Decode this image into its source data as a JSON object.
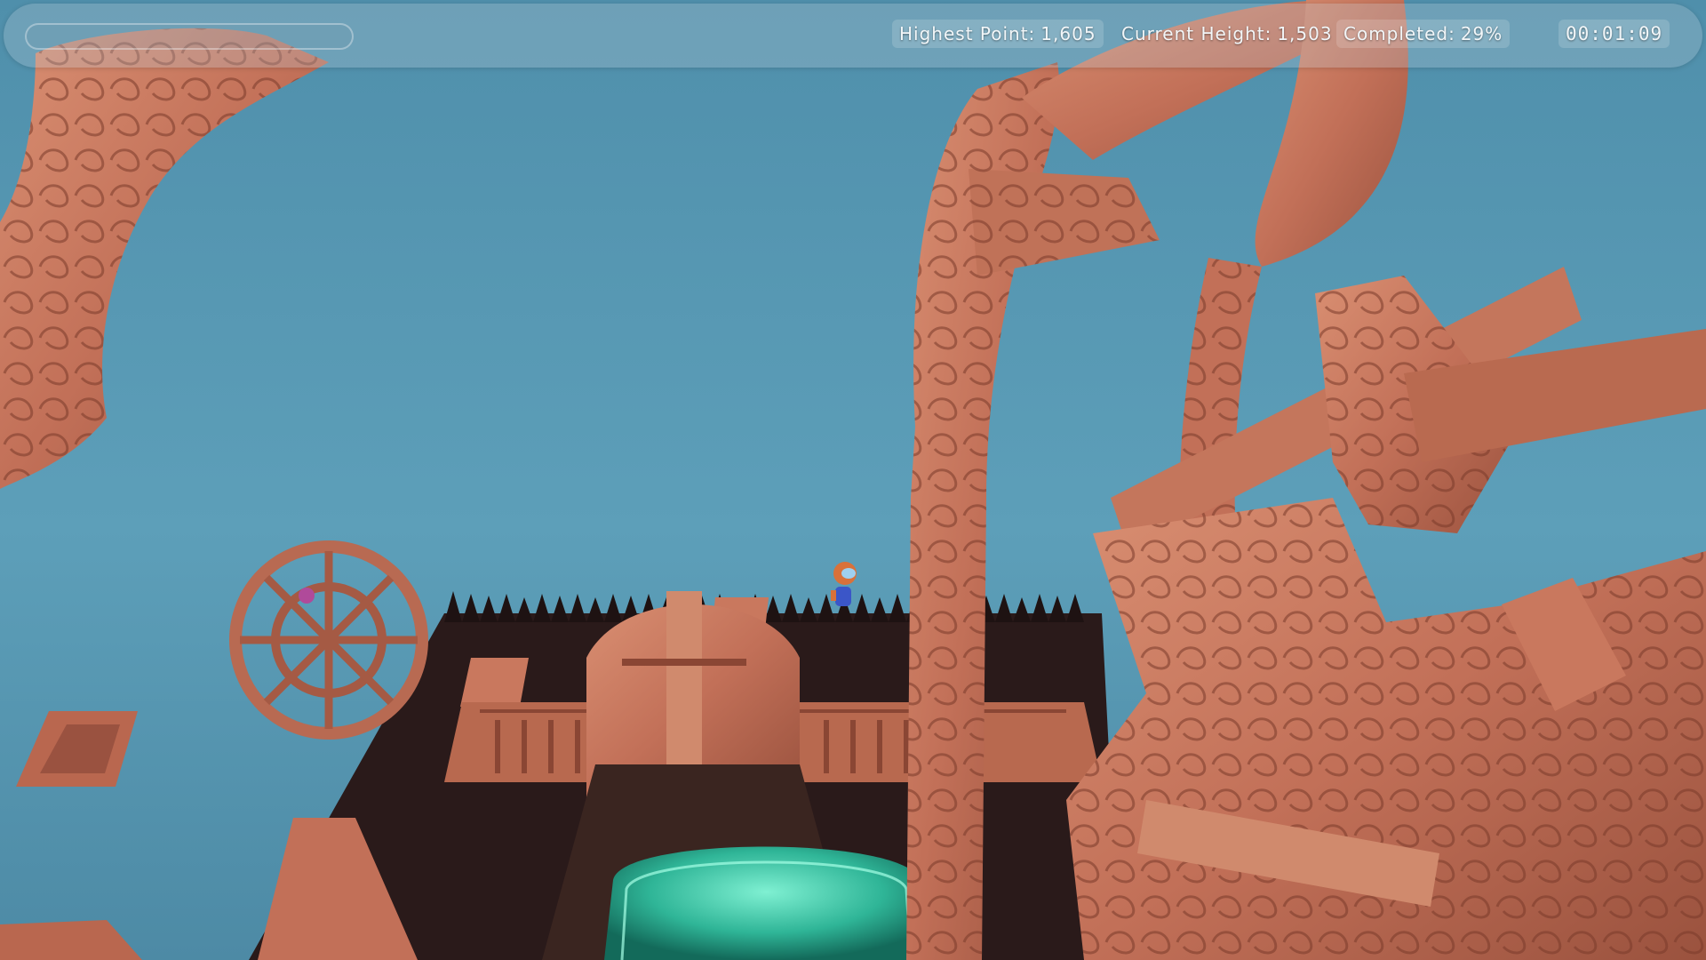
{
  "hud": {
    "highest_point_label": "Highest Point:",
    "highest_point_value": "1,605",
    "current_height_label": "Current Height:",
    "current_height_value": "1,503",
    "completed_label": "Completed:",
    "completed_value": "29%",
    "progress_fraction": 0.0,
    "timer": "00:01:09"
  },
  "colors": {
    "sky": "#5a9bb5",
    "stone": "#c9785e",
    "stone_dark": "#8a4634",
    "spikes": "#2a1a1a",
    "water": "#3fd0b0",
    "hud_text": "#f2f6f8"
  },
  "icons": [
    "player-character",
    "water-portal",
    "floating-tile",
    "spike-wall"
  ]
}
